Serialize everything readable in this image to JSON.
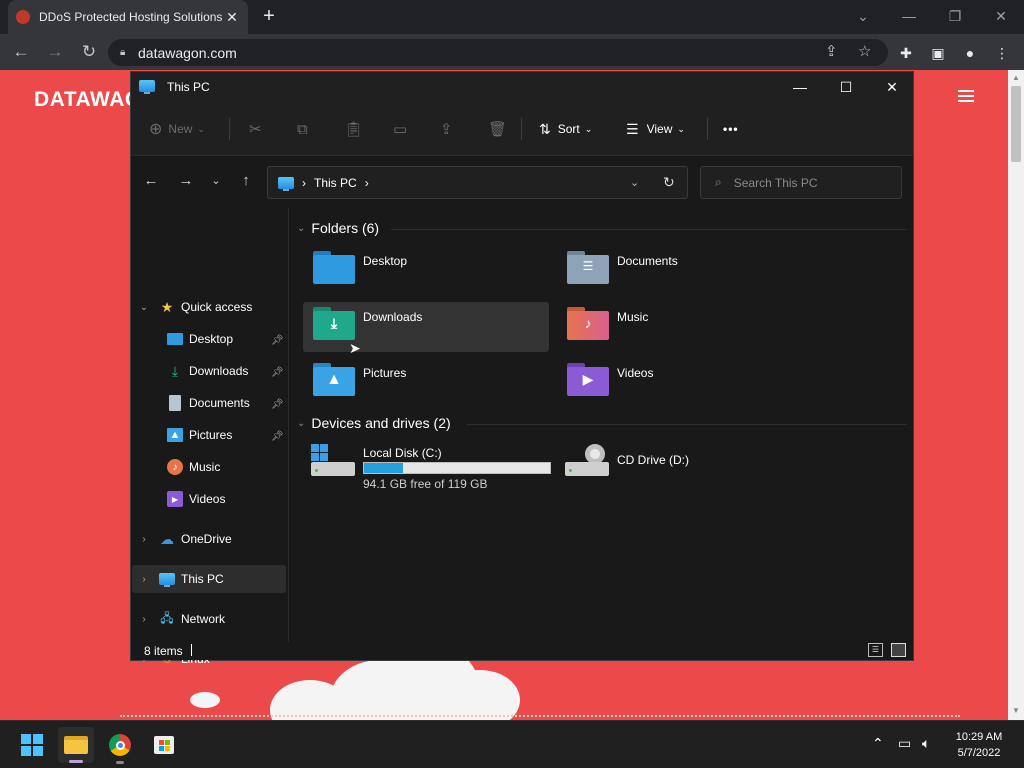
{
  "browser": {
    "tab_title": "DDoS Protected Hosting Solutions",
    "tab_close": "✕",
    "new_tab": "+",
    "url": "datawagon.com"
  },
  "website": {
    "brand": "DATAWAGON"
  },
  "explorer": {
    "window_title": "This PC",
    "toolbar": {
      "new_label": "New",
      "sort_label": "Sort",
      "view_label": "View",
      "more_label": "•••"
    },
    "address": {
      "segment": "This PC",
      "separator": "›"
    },
    "search_placeholder": "Search This PC",
    "nav_pane": {
      "quick_access": "Quick access",
      "items": [
        {
          "label": "Desktop",
          "pinned": true
        },
        {
          "label": "Downloads",
          "pinned": true
        },
        {
          "label": "Documents",
          "pinned": true
        },
        {
          "label": "Pictures",
          "pinned": true
        },
        {
          "label": "Music",
          "pinned": false
        },
        {
          "label": "Videos",
          "pinned": false
        }
      ],
      "onedrive": "OneDrive",
      "this_pc": "This PC",
      "network": "Network",
      "linux": "Linux"
    },
    "folders_header": "Folders (6)",
    "folders": [
      {
        "name": "Desktop",
        "color": "#2e9be0"
      },
      {
        "name": "Documents",
        "color": "#8fa3b8"
      },
      {
        "name": "Downloads",
        "color": "#1fa98a"
      },
      {
        "name": "Music",
        "color": "#e6744d"
      },
      {
        "name": "Pictures",
        "color": "#3aa3e6"
      },
      {
        "name": "Videos",
        "color": "#8b5bd6"
      }
    ],
    "drives_header": "Devices and drives (2)",
    "drives": [
      {
        "name": "Local Disk (C:)",
        "free_text": "94.1 GB free of 119 GB",
        "used_fraction": 0.21
      },
      {
        "name": "CD Drive (D:)"
      }
    ],
    "status_items": "8 items"
  },
  "taskbar": {
    "time": "10:29 AM",
    "date": "5/7/2022"
  }
}
